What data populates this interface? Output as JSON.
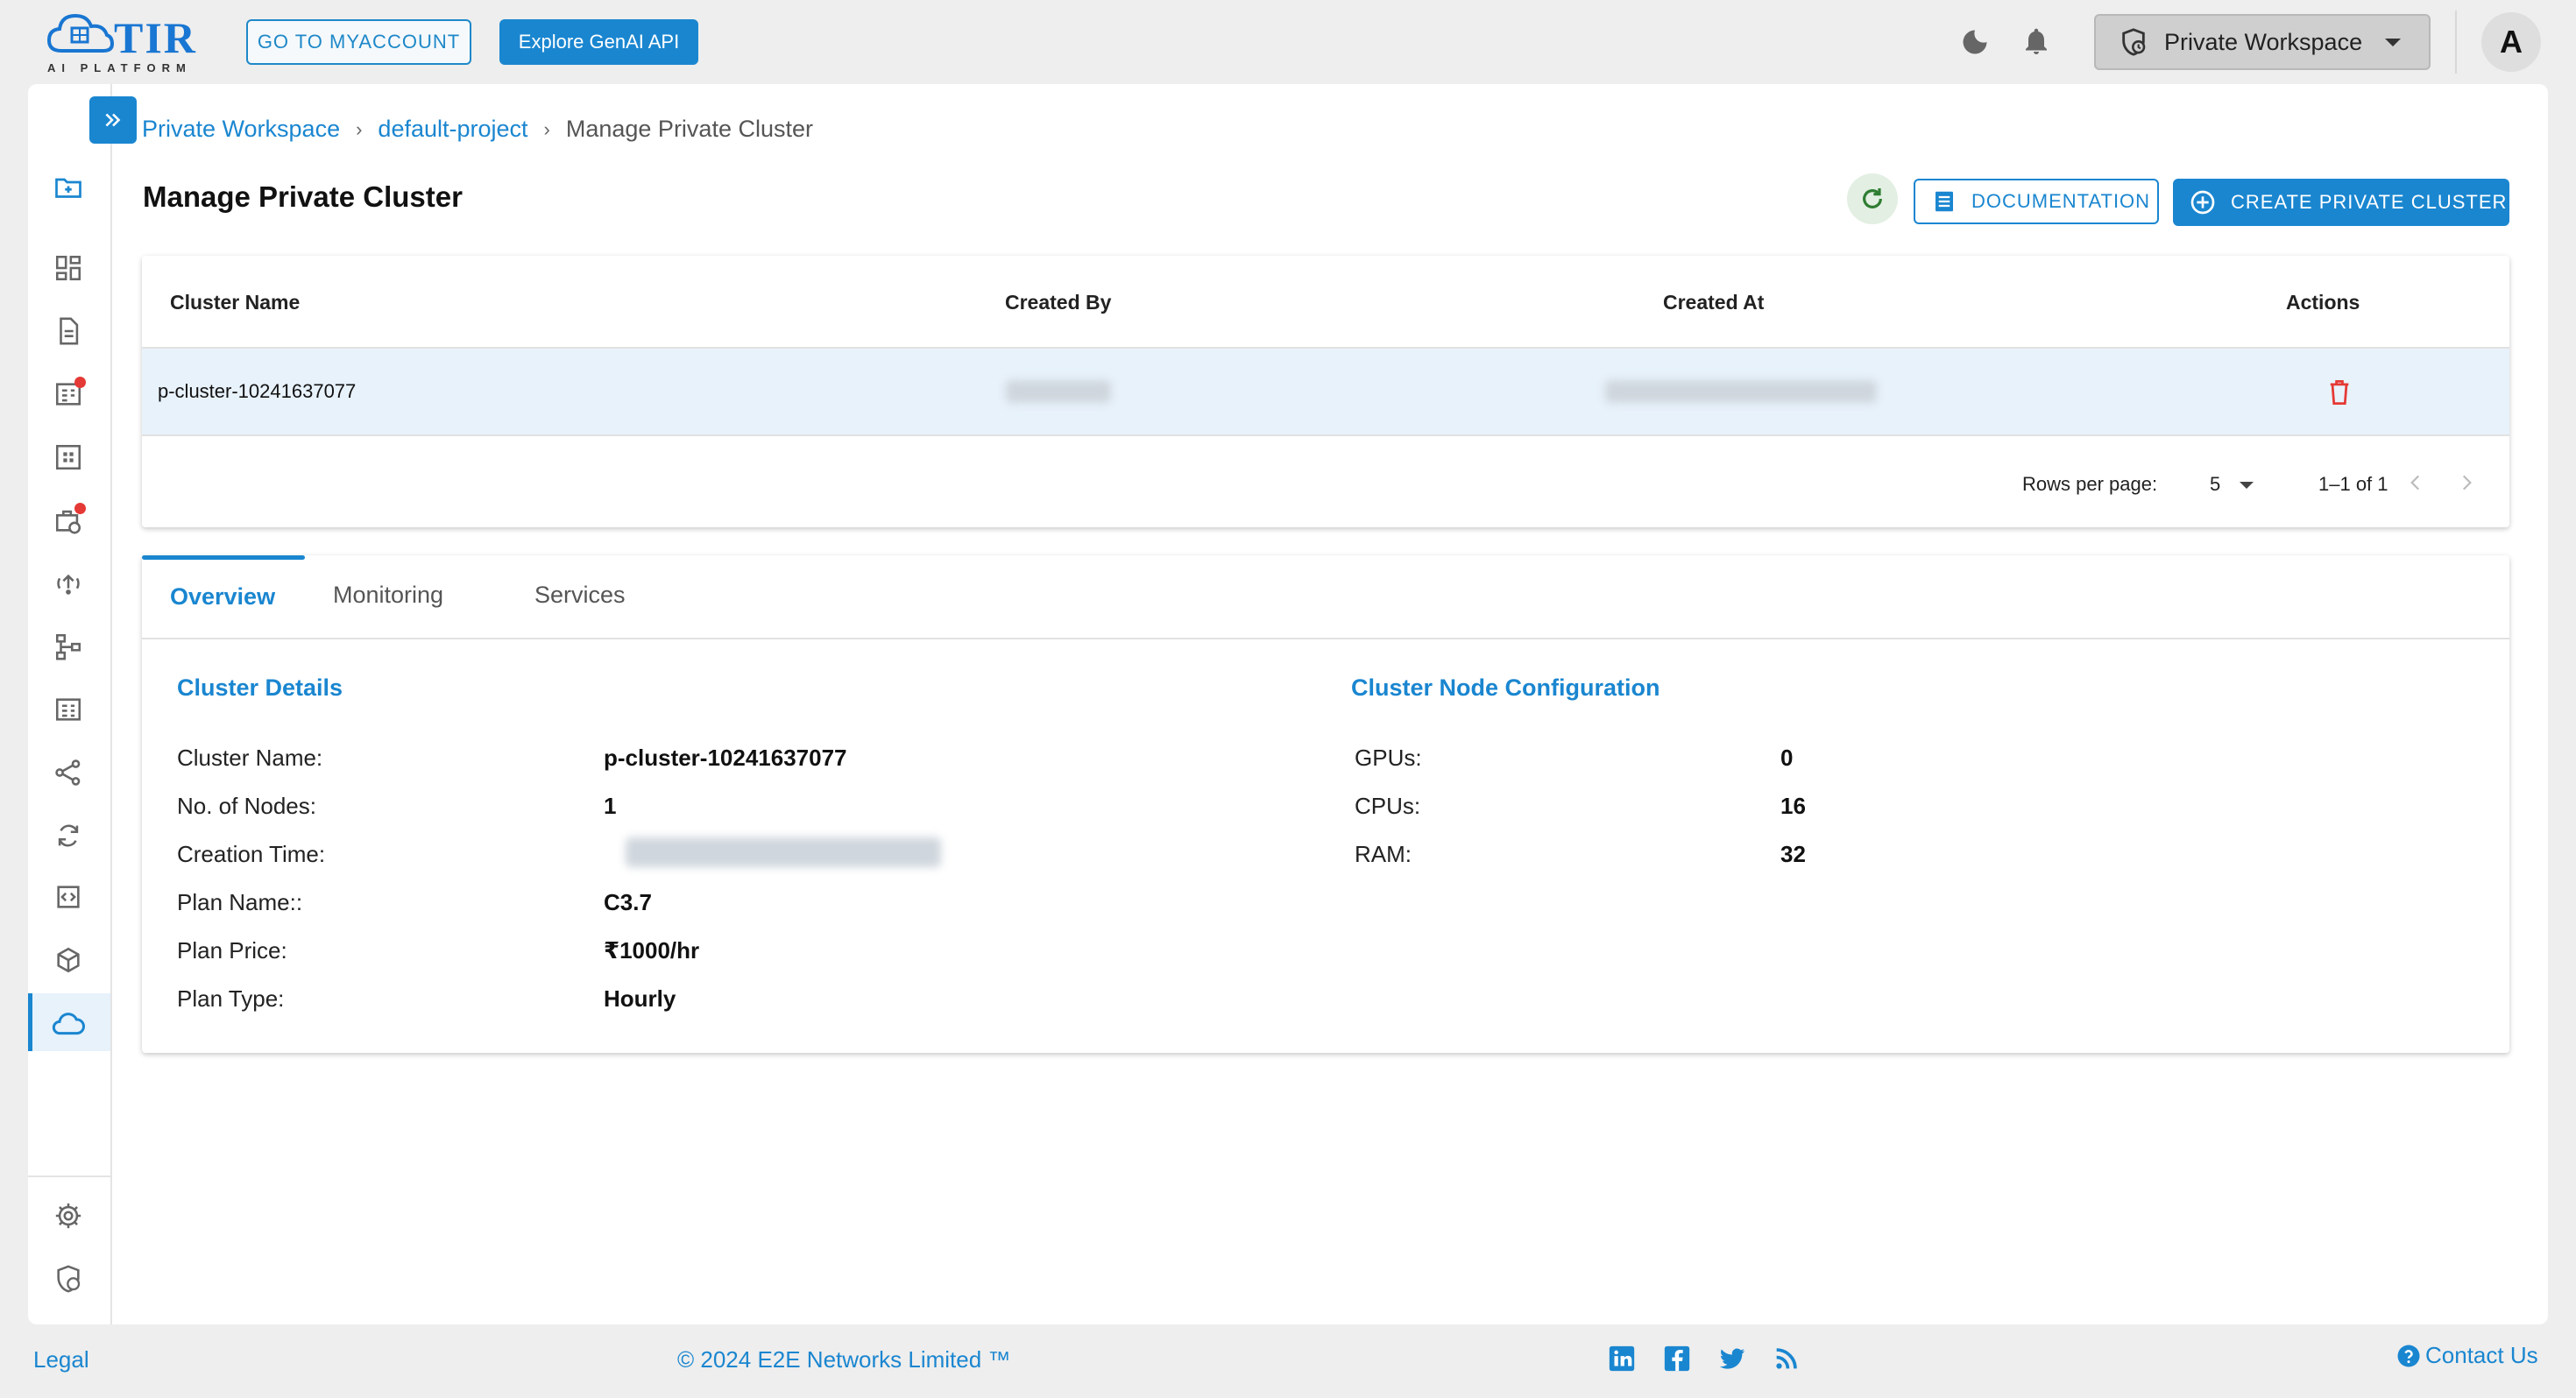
{
  "header": {
    "logo_text": "TIR",
    "logo_subtext": "AI PLATFORM",
    "myaccount_label": "GO TO MYACCOUNT",
    "genai_label": "Explore GenAI API",
    "workspace_label": "Private Workspace",
    "avatar_initial": "A"
  },
  "breadcrumb": {
    "items": [
      "Private Workspace",
      "default-project",
      "Manage Private Cluster"
    ],
    "separator": "›"
  },
  "page": {
    "title": "Manage Private Cluster",
    "documentation_label": "DOCUMENTATION",
    "create_label": "CREATE PRIVATE CLUSTER"
  },
  "table": {
    "columns": [
      "Cluster Name",
      "Created By",
      "Created At",
      "Actions"
    ],
    "rows": [
      {
        "cluster_name": "p-cluster-10241637077"
      }
    ],
    "rows_per_page_label": "Rows per page:",
    "rows_per_page_value": "5",
    "pagination": "1–1 of 1"
  },
  "tabs": [
    "Overview",
    "Monitoring",
    "Services"
  ],
  "active_tab": "Overview",
  "cluster_details": {
    "title": "Cluster Details",
    "items": [
      {
        "label": "Cluster Name:",
        "value": "p-cluster-10241637077"
      },
      {
        "label": "No. of Nodes:",
        "value": "1"
      },
      {
        "label": "Creation Time:",
        "value": ""
      },
      {
        "label": "Plan Name::",
        "value": "C3.7"
      },
      {
        "label": "Plan Price:",
        "value": "₹1000/hr"
      },
      {
        "label": "Plan Type:",
        "value": "Hourly"
      }
    ]
  },
  "node_config": {
    "title": "Cluster Node Configuration",
    "items": [
      {
        "label": "GPUs:",
        "value": "0"
      },
      {
        "label": "CPUs:",
        "value": "16"
      },
      {
        "label": "RAM:",
        "value": "32"
      }
    ]
  },
  "footer": {
    "legal": "Legal",
    "copyright": "© 2024 E2E Networks Limited ™",
    "contact": "Contact Us"
  },
  "colors": {
    "accent": "#1a86d0",
    "danger": "#e53935",
    "refresh": "#2e7d32",
    "selected_row": "#e8f2fb"
  },
  "icons": {
    "sidebar": [
      "folder-add-icon",
      "dashboard-icon",
      "document-icon",
      "datasets-icon",
      "grid-icon",
      "schedule-icon",
      "inference-icon",
      "pipeline-icon",
      "table-icon",
      "share-icon",
      "sync-icon",
      "code-icon",
      "cube-icon",
      "cloud-icon",
      "settings-icon",
      "security-icon"
    ],
    "social": [
      "linkedin-icon",
      "facebook-icon",
      "twitter-icon",
      "rss-icon"
    ]
  }
}
